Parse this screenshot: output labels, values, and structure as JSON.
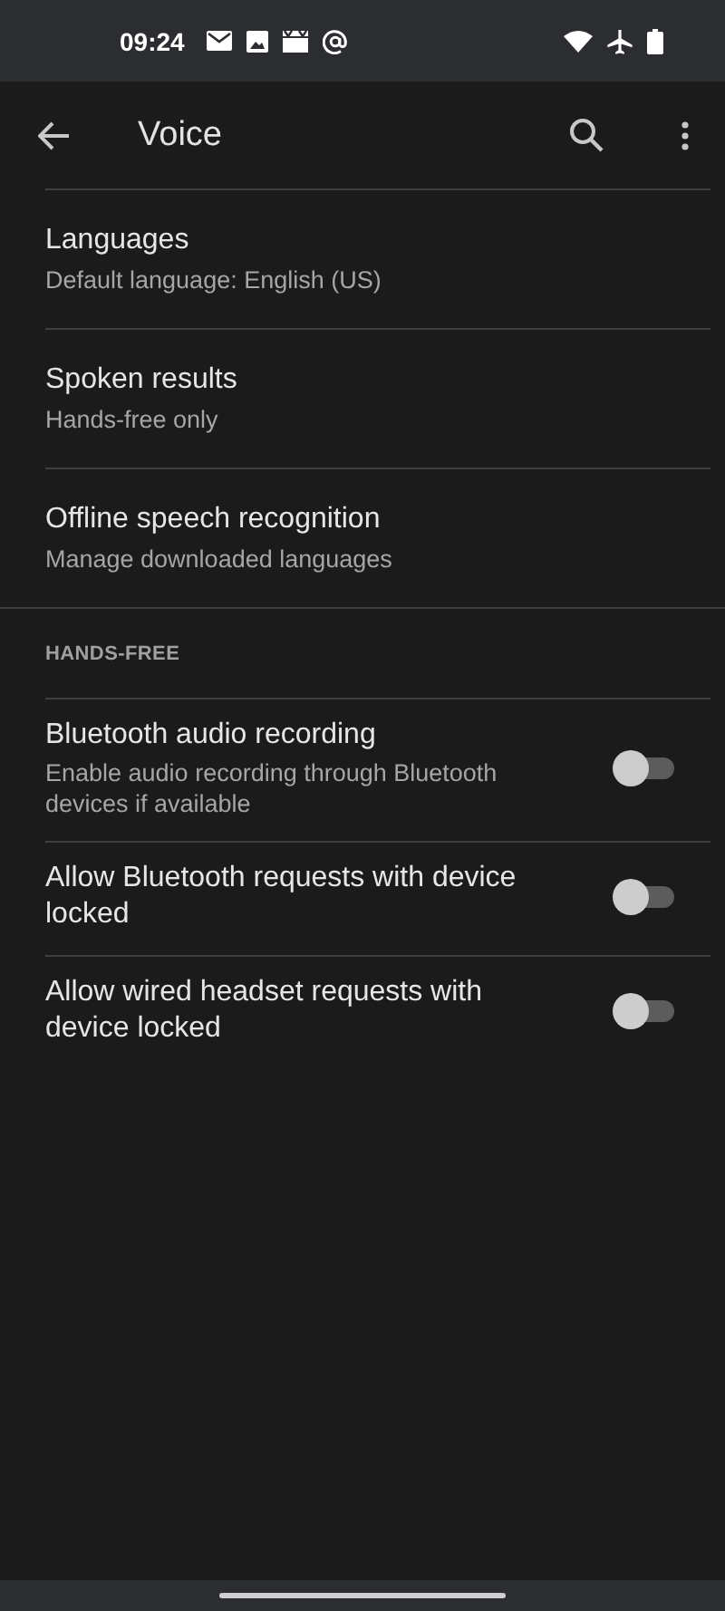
{
  "status_bar": {
    "time": "09:24"
  },
  "toolbar": {
    "title": "Voice"
  },
  "settings": [
    {
      "title": "Languages",
      "summary": "Default language: English (US)"
    },
    {
      "title": "Spoken results",
      "summary": "Hands-free only"
    },
    {
      "title": "Offline speech recognition",
      "summary": "Manage downloaded languages"
    }
  ],
  "hands_free": {
    "header": "HANDS-FREE",
    "items": [
      {
        "title": "Bluetooth audio recording",
        "summary": "Enable audio recording through Bluetooth devices if available",
        "on": false
      },
      {
        "title": "Allow Bluetooth requests with device locked",
        "on": false
      },
      {
        "title": "Allow wired headset requests with device locked",
        "on": false
      }
    ]
  }
}
